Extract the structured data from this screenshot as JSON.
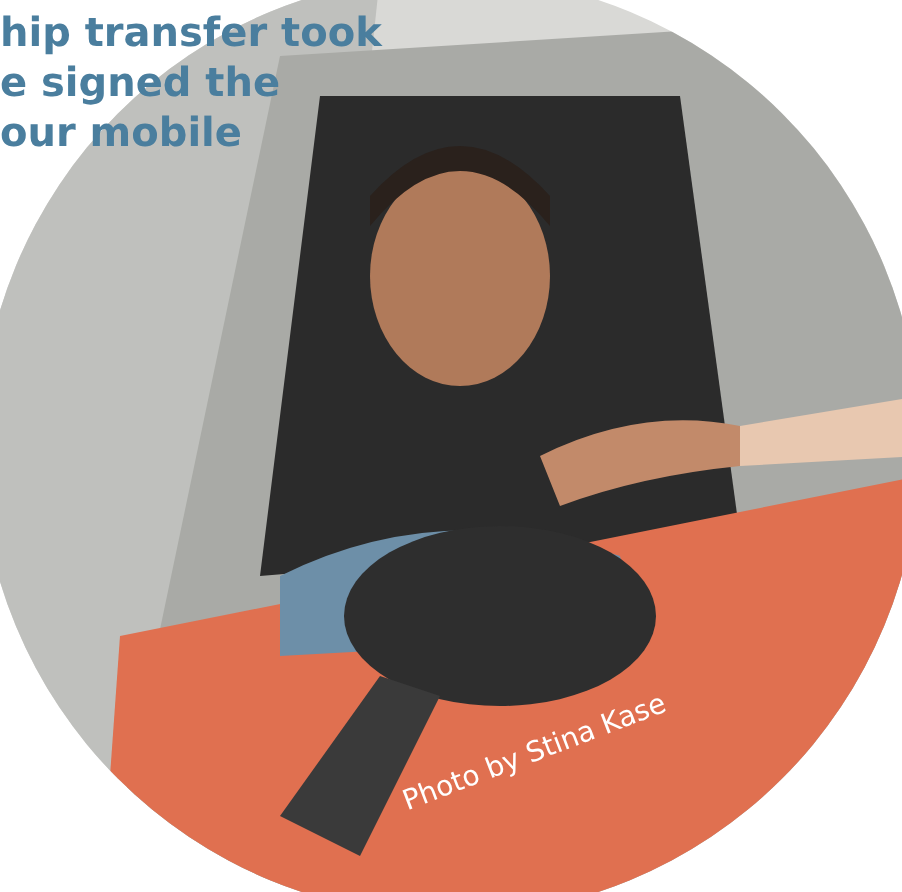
{
  "intro": {
    "lines": [
      "hip transfer took",
      "e signed the",
      "our mobile"
    ]
  },
  "photo": {
    "kind": "picture",
    "caption": "Photo by Stina Kase"
  }
}
